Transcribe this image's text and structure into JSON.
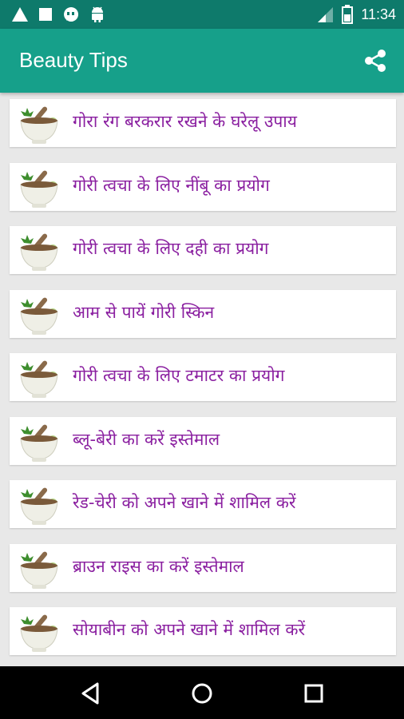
{
  "status_bar": {
    "time": "11:34",
    "icons_left": [
      "warning-icon",
      "stop-icon",
      "hangouts-icon",
      "android-icon"
    ],
    "icons_right": [
      "signal-icon",
      "battery-icon"
    ]
  },
  "app_bar": {
    "title": "Beauty Tips",
    "share_icon": "share-icon"
  },
  "list": {
    "items": [
      {
        "label": "गोरा रंग बरकरार रखने के  घरेलू उपाय"
      },
      {
        "label": "गोरी त्वचा के  लिए नींबू का प्रयोग"
      },
      {
        "label": "गोरी त्वचा के  लिए दही का प्रयोग"
      },
      {
        "label": "आम से पायें गोरी स्किन"
      },
      {
        "label": "गोरी त्वचा के  लिए टमाटर का प्रयोग"
      },
      {
        "label": "ब्लू-बेरी का करें इस्तेमाल"
      },
      {
        "label": "रेड-चेरी को अपने खाने में शामिल करें"
      },
      {
        "label": "ब्राउन राइस का करें इस्तेमाल"
      },
      {
        "label": "सोयाबीन को अपने खाने में शामिल करें"
      }
    ]
  },
  "nav_bar": {
    "buttons": [
      "back-icon",
      "home-icon",
      "recents-icon"
    ]
  },
  "colors": {
    "status_bar": "#0e7a6b",
    "app_bar": "#16a08a",
    "item_text": "#8a1fa0",
    "background": "#e8e8e8"
  }
}
